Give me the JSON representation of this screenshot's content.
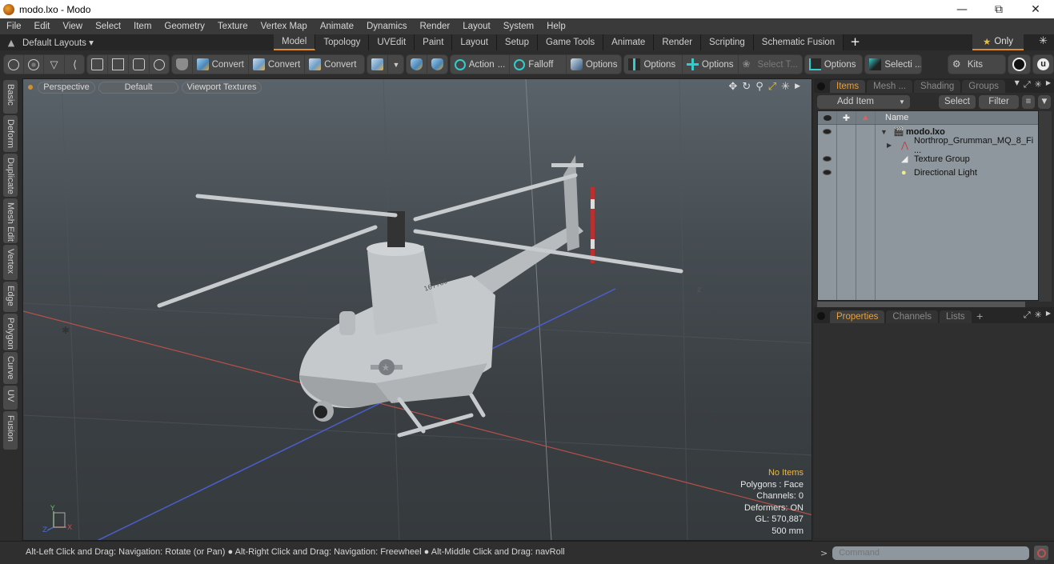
{
  "window": {
    "title": "modo.lxo - Modo",
    "controls": [
      "minimize",
      "restore",
      "close"
    ]
  },
  "menubar": {
    "items": [
      "File",
      "Edit",
      "View",
      "Select",
      "Item",
      "Geometry",
      "Texture",
      "Vertex Map",
      "Animate",
      "Dynamics",
      "Render",
      "Layout",
      "System",
      "Help"
    ]
  },
  "layoutbar": {
    "layouts_label": "Default Layouts ▾",
    "tabs": [
      "Model",
      "Topology",
      "UVEdit",
      "Paint",
      "Layout",
      "Setup",
      "Game Tools",
      "Animate",
      "Render",
      "Scripting",
      "Schematic Fusion"
    ],
    "active_tab": "Model",
    "add_tab": "+",
    "only_label": "Only"
  },
  "toolbar": {
    "convert1": "Convert",
    "convert2": "Convert",
    "convert3": "Convert",
    "action": "Action",
    "action_more": "...",
    "falloff": "Falloff",
    "options1": "Options",
    "options2": "Options",
    "options3": "Options",
    "select_t": "Select T...",
    "options4": "Options",
    "selecti": "Selecti ...",
    "kits": "Kits"
  },
  "left_tabs": [
    "Basic",
    "Deform",
    "Duplicate",
    "Mesh Edit",
    "Vertex",
    "Edge",
    "Polygon",
    "Curve",
    "UV",
    "Fusion"
  ],
  "viewport": {
    "view_mode": "Perspective",
    "shading": "Default",
    "textures": "Viewport Textures",
    "hud": {
      "selection": "No Items",
      "polygons": "Polygons : Face",
      "channels": "Channels: 0",
      "deformers": "Deformers: ON",
      "gl": "GL: 570,887",
      "grid": "500 mm"
    },
    "axis_labels": {
      "x": "X",
      "y": "Y",
      "z": "Z"
    },
    "axis_colors": {
      "x": "#c0504a",
      "y": "#5cc05c",
      "z": "#4a6ad0"
    },
    "model_label": "167780"
  },
  "statusbar": {
    "hint1": "Alt-Left Click and Drag: Navigation: Rotate (or Pan)",
    "hint2": "Alt-Right Click and Drag: Navigation: Freewheel",
    "hint3": "Alt-Middle Click and Drag: navRoll",
    "separator": "●"
  },
  "items_panel": {
    "tabs": [
      "Items",
      "Mesh ...",
      "Shading",
      "Groups"
    ],
    "active_tab": "Items",
    "add_item": "Add Item",
    "select": "Select",
    "filter": "Filter",
    "column_name": "Name",
    "tree": [
      {
        "label": "modo.lxo",
        "icon": "scene-clapper-icon",
        "expanded": true,
        "visible": true,
        "bold": true
      },
      {
        "label": "Northrop_Grumman_MQ_8_Fi ...",
        "icon": "locator-icon",
        "expanded": false,
        "visible": false,
        "bold": false
      },
      {
        "label": "Texture Group",
        "icon": "texture-folder-icon",
        "visible": true,
        "bold": false
      },
      {
        "label": "Directional Light",
        "icon": "light-icon",
        "visible": true,
        "bold": false
      }
    ]
  },
  "properties_panel": {
    "tabs": [
      "Properties",
      "Channels",
      "Lists"
    ],
    "active_tab": "Properties",
    "add_tab": "+"
  },
  "command": {
    "prompt": ">",
    "placeholder": "Command"
  },
  "colors": {
    "accent": "#e08a2a",
    "active_tab_text": "#e8a03a",
    "hud_highlight": "#e8b84a"
  }
}
